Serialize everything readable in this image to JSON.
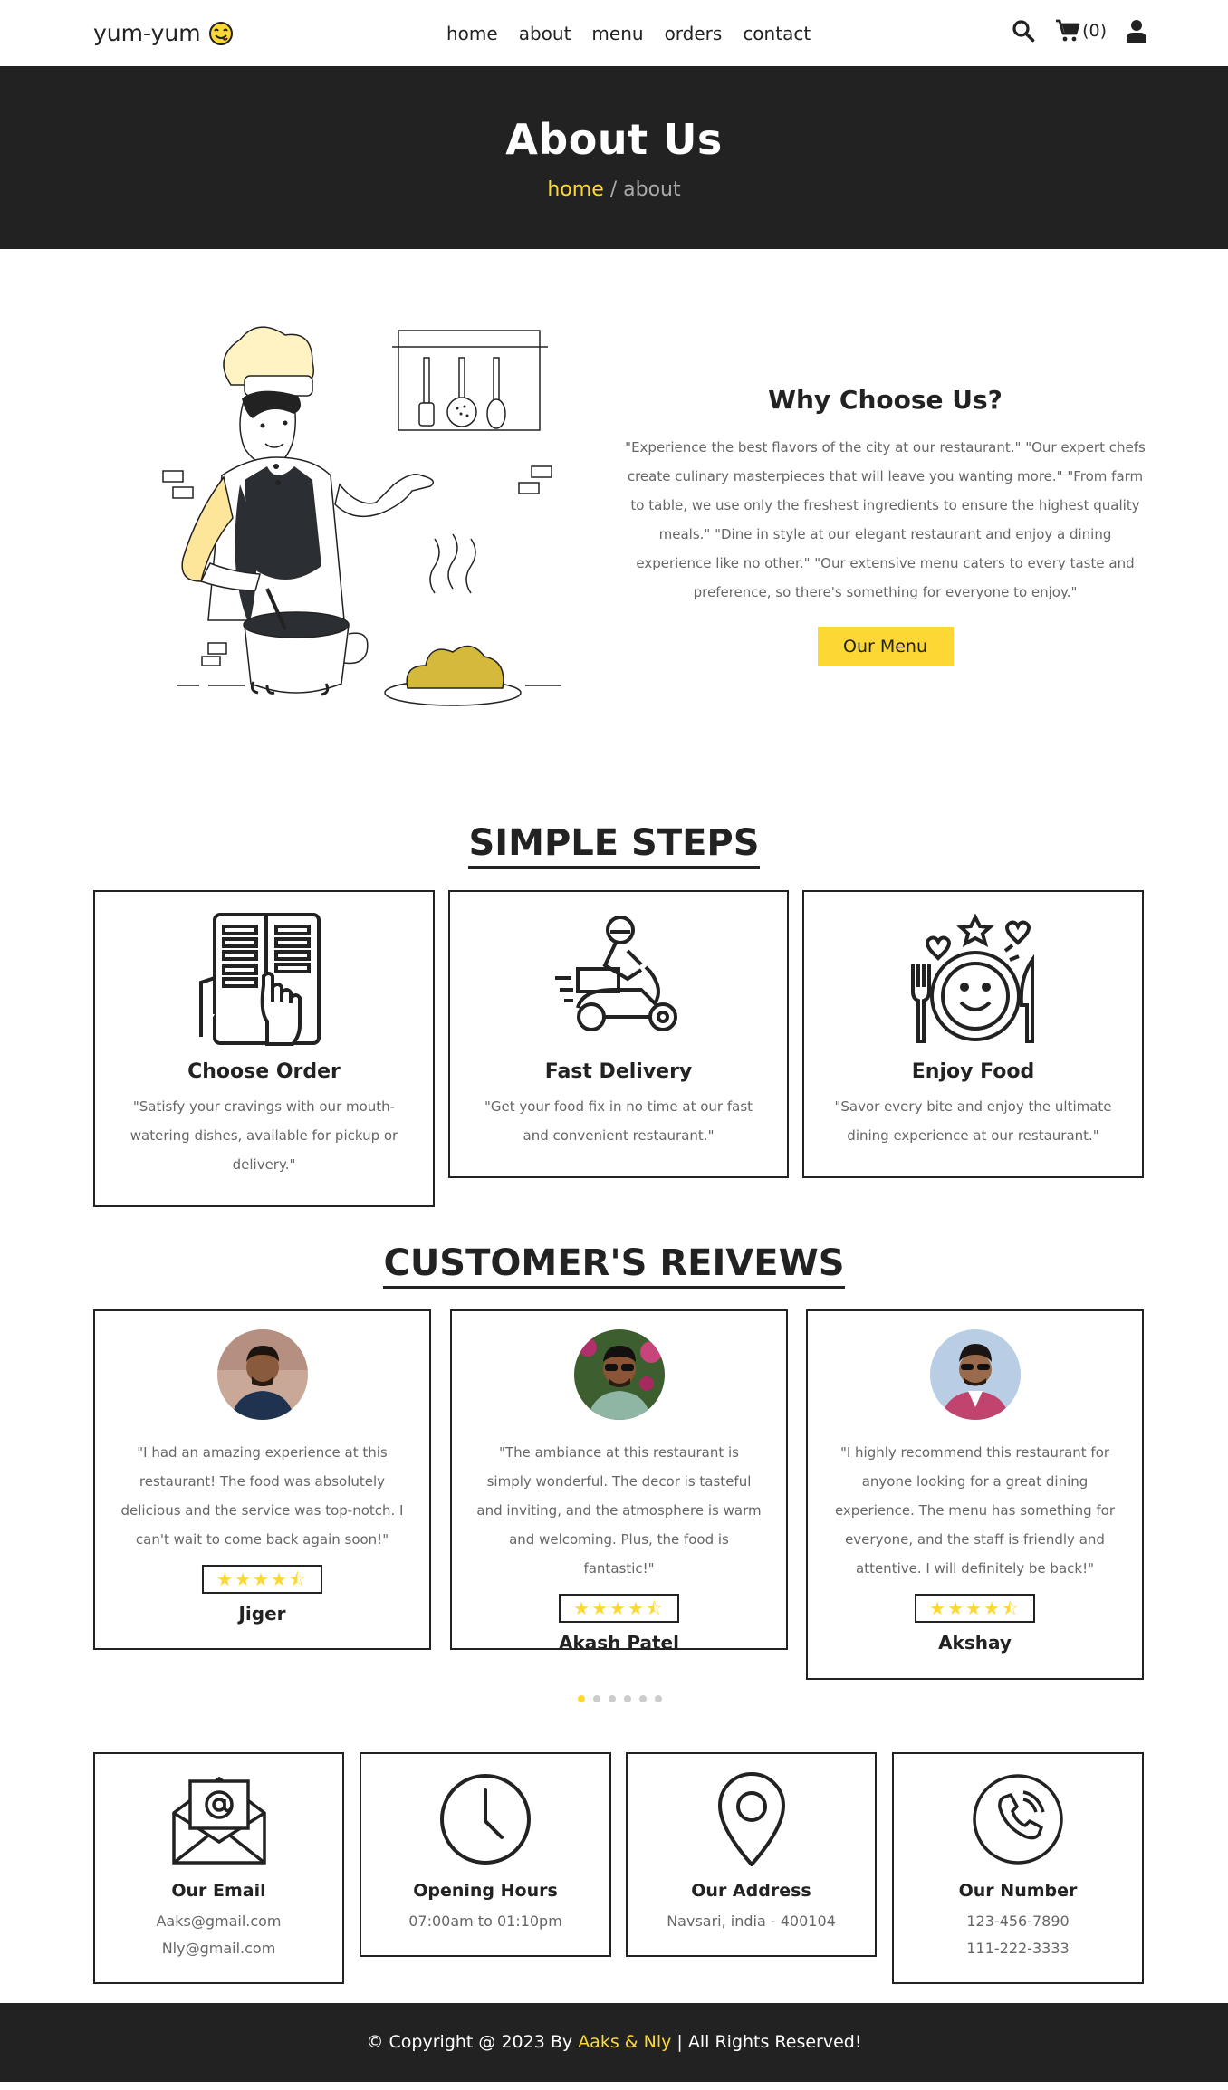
{
  "header": {
    "logo_text": "yum-yum",
    "nav": [
      "home",
      "about",
      "menu",
      "orders",
      "contact"
    ],
    "cart_count": "(0)",
    "icons": [
      "search-icon",
      "cart-icon",
      "user-icon"
    ]
  },
  "hero": {
    "title": "About Us",
    "breadcrumb_home": "home",
    "breadcrumb_current": "/ about"
  },
  "about": {
    "heading": "Why Choose Us?",
    "text": "\"Experience the best flavors of the city at our restaurant.\" \"Our expert chefs create culinary masterpieces that will leave you wanting more.\" \"From farm to table, we use only the freshest ingredients to ensure the highest quality meals.\" \"Dine in style at our elegant restaurant and enjoy a dining experience like no other.\" \"Our extensive menu caters to every taste and preference, so there's something for everyone to enjoy.\"",
    "button": "Our Menu"
  },
  "steps": {
    "title": "SIMPLE STEPS",
    "items": [
      {
        "title": "Choose Order",
        "text": "\"Satisfy your cravings with our mouth-watering dishes, available for pickup or delivery.\"",
        "icon": "menu-order-icon"
      },
      {
        "title": "Fast Delivery",
        "text": "\"Get your food fix in no time at our fast and convenient restaurant.\"",
        "icon": "delivery-scooter-icon"
      },
      {
        "title": "Enjoy Food",
        "text": "\"Savor every bite and enjoy the ultimate dining experience at our restaurant.\"",
        "icon": "smile-plate-icon"
      }
    ]
  },
  "reviews": {
    "title": "CUSTOMER'S REIVEWS",
    "items": [
      {
        "name": "Jiger",
        "text": "\"I had an amazing experience at this restaurant! The food was absolutely delicious and the service was top-notch. I can't wait to come back again soon!\"",
        "rating": 4.5
      },
      {
        "name": "Akash Patel",
        "text": "\"The ambiance at this restaurant is simply wonderful. The decor is tasteful and inviting, and the atmosphere is warm and welcoming. Plus, the food is fantastic!\"",
        "rating": 4.5
      },
      {
        "name": "Akshay",
        "text": "\"I highly recommend this restaurant for anyone looking for a great dining experience. The menu has something for everyone, and the staff is friendly and attentive. I will definitely be back!\"",
        "rating": 4.5
      }
    ],
    "stars_display": "★★★★⯪",
    "slides": 6,
    "active_slide": 1
  },
  "info": [
    {
      "title": "Our Email",
      "lines": [
        "Aaks@gmail.com",
        "Nly@gmail.com"
      ],
      "icon": "email-icon"
    },
    {
      "title": "Opening Hours",
      "lines": [
        "07:00am to 01:10pm"
      ],
      "icon": "clock-icon"
    },
    {
      "title": "Our Address",
      "lines": [
        "Navsari, india - 400104"
      ],
      "icon": "location-pin-icon"
    },
    {
      "title": "Our Number",
      "lines": [
        "123-456-7890",
        "111-222-3333"
      ],
      "icon": "phone-icon"
    }
  ],
  "footer": {
    "prefix": "© Copyright @ 2023 By",
    "authors": "Aaks & Nly",
    "suffix": "| All Rights Reserved!"
  },
  "colors": {
    "accent": "#fdd835",
    "dark": "#222222",
    "muted": "#666666"
  }
}
